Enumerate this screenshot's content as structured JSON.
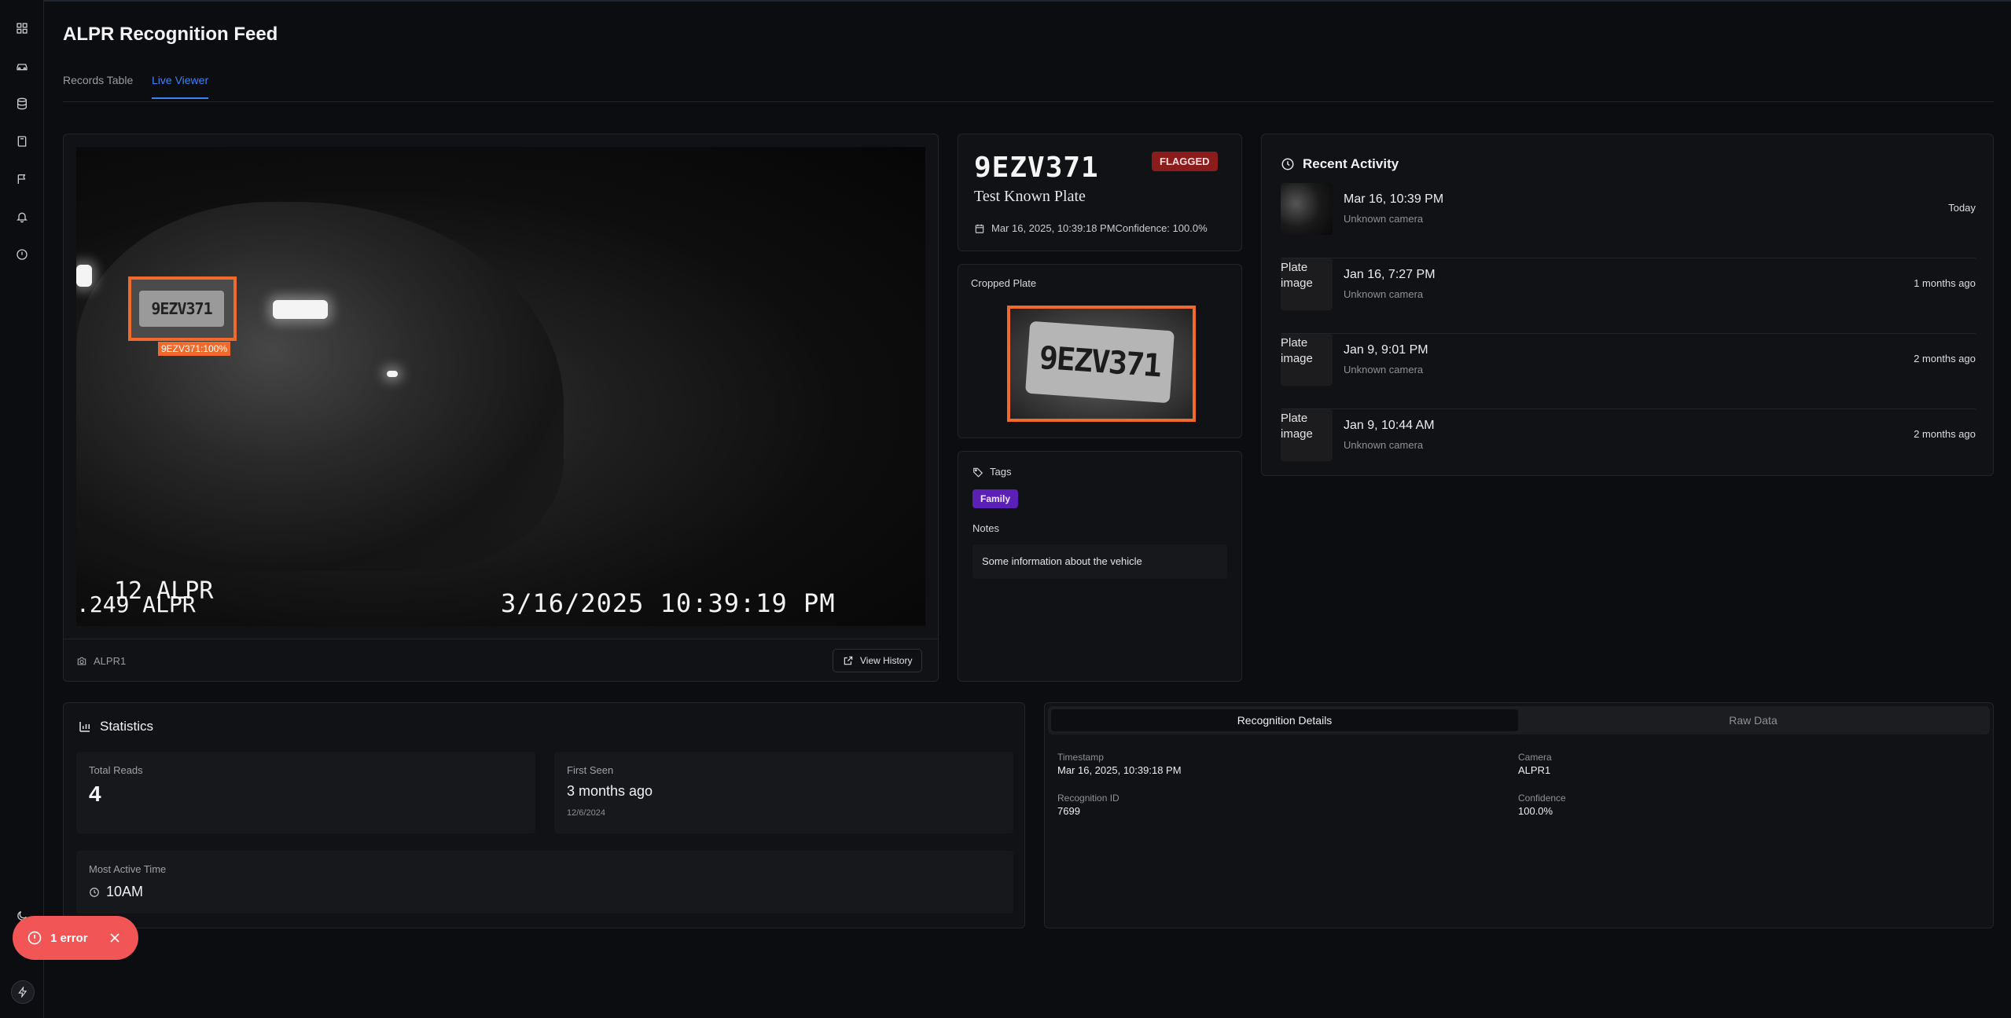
{
  "header": {
    "title": "ALPR Recognition Feed"
  },
  "tabs": [
    {
      "label": "Records Table"
    },
    {
      "label": "Live Viewer"
    }
  ],
  "viewer": {
    "detection_label": "9EZV371:100%",
    "plate_text": "9EZV371",
    "osd_line1": "12 ALPR",
    "osd_line2": ".249 ALPR",
    "osd_timestamp": "3/16/2025 10:39:19 PM",
    "camera": "ALPR1",
    "view_history": "View History"
  },
  "plate": {
    "number": "9EZV371",
    "status": "FLAGGED",
    "description": "Test Known Plate",
    "meta": "Mar 16, 2025, 10:39:18 PMConfidence: 100.0%",
    "status_color": "#8b1c1c"
  },
  "cropped": {
    "label": "Cropped Plate",
    "plate_text": "9EZV371"
  },
  "tags": {
    "label": "Tags",
    "items": [
      {
        "name": "Family",
        "color": "#5b21b6"
      }
    ],
    "notes_label": "Notes",
    "notes": "Some information about the vehicle"
  },
  "activity": {
    "title": "Recent Activity",
    "items": [
      {
        "thumb": "",
        "date": "Mar 16, 10:39 PM",
        "camera": "Unknown camera",
        "ago": "Today"
      },
      {
        "thumb": "Plate image",
        "date": "Jan 16, 7:27 PM",
        "camera": "Unknown camera",
        "ago": "1 months ago"
      },
      {
        "thumb": "Plate image",
        "date": "Jan 9, 9:01 PM",
        "camera": "Unknown camera",
        "ago": "2 months ago"
      },
      {
        "thumb": "Plate image",
        "date": "Jan 9, 10:44 AM",
        "camera": "Unknown camera",
        "ago": "2 months ago"
      }
    ]
  },
  "stats": {
    "title": "Statistics",
    "total_reads_label": "Total Reads",
    "total_reads": "4",
    "first_seen_label": "First Seen",
    "first_seen": "3 months ago",
    "first_seen_date": "12/6/2024",
    "most_active_label": "Most Active Time",
    "most_active": "10AM"
  },
  "details": {
    "tabs": [
      "Recognition Details",
      "Raw Data"
    ],
    "timestamp_label": "Timestamp",
    "timestamp": "Mar 16, 2025, 10:39:18 PM",
    "camera_label": "Camera",
    "camera": "ALPR1",
    "id_label": "Recognition ID",
    "id": "7699",
    "confidence_label": "Confidence",
    "confidence": "100.0%"
  },
  "toast": {
    "text": "1 error",
    "color": "#f25555"
  },
  "sidebar": {
    "icons": [
      "dashboard-icon",
      "car-icon",
      "database-icon",
      "book-icon",
      "flag-icon",
      "bell-icon",
      "power-icon"
    ],
    "bottom_icons": [
      "moon-icon",
      "bolt-icon"
    ]
  },
  "accent_color": "#3b82f6",
  "detection_color": "#f06a2c"
}
